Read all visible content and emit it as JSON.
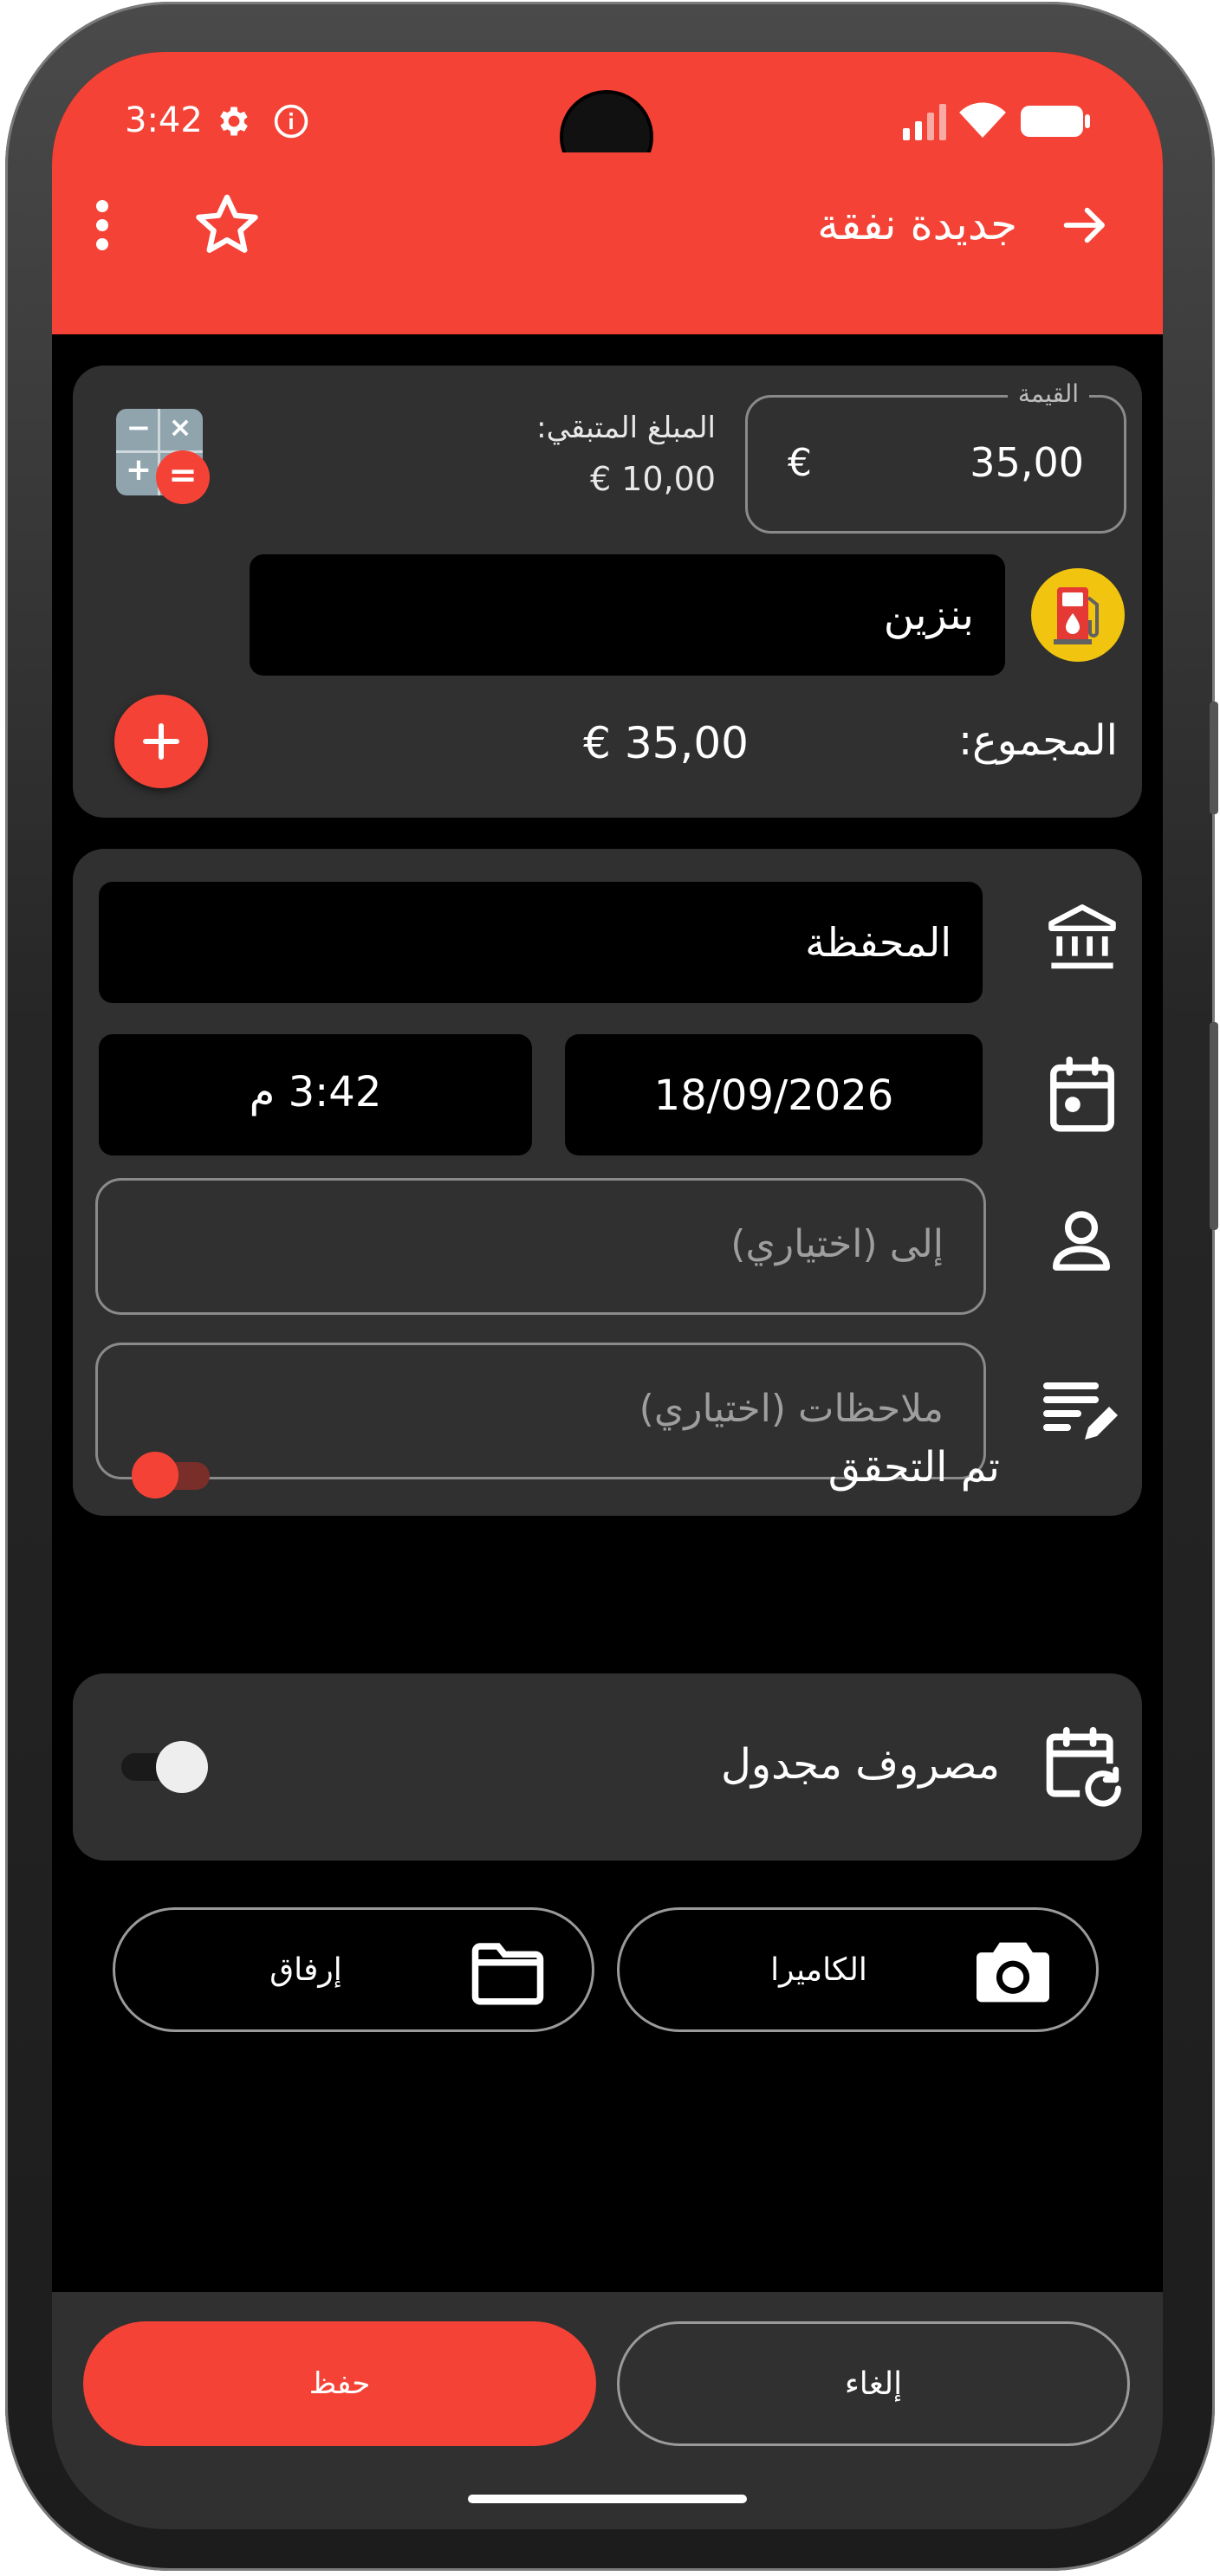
{
  "status": {
    "time": "3:42"
  },
  "appbar": {
    "title": "جديدة نفقة"
  },
  "amount": {
    "label": "القيمة",
    "value": "35,00",
    "currency": "€"
  },
  "remaining": {
    "label": "المبلغ المتبقي:",
    "value": "€ 10,00"
  },
  "category": {
    "name": "بنزين"
  },
  "total": {
    "label": "المجموع:",
    "value": "€ 35,00"
  },
  "wallet": {
    "name": "المحفظة"
  },
  "datetime": {
    "date": "18/09/2026",
    "time": "3:42 م"
  },
  "payee": {
    "placeholder": "إلى (اختياري)"
  },
  "notes": {
    "placeholder": "ملاحظات (اختياري)"
  },
  "verified": {
    "label": "تم التحقق",
    "on": true
  },
  "scheduled": {
    "label": "مصروف مجدول",
    "on": false
  },
  "attachments": {
    "camera_label": "الكاميرا",
    "attach_label": "إرفاق"
  },
  "bottom": {
    "save_label": "حفظ",
    "cancel_label": "إلغاء"
  },
  "colors": {
    "accent": "#f44336",
    "card": "#303030",
    "category_icon_bg": "#f1c40f"
  }
}
